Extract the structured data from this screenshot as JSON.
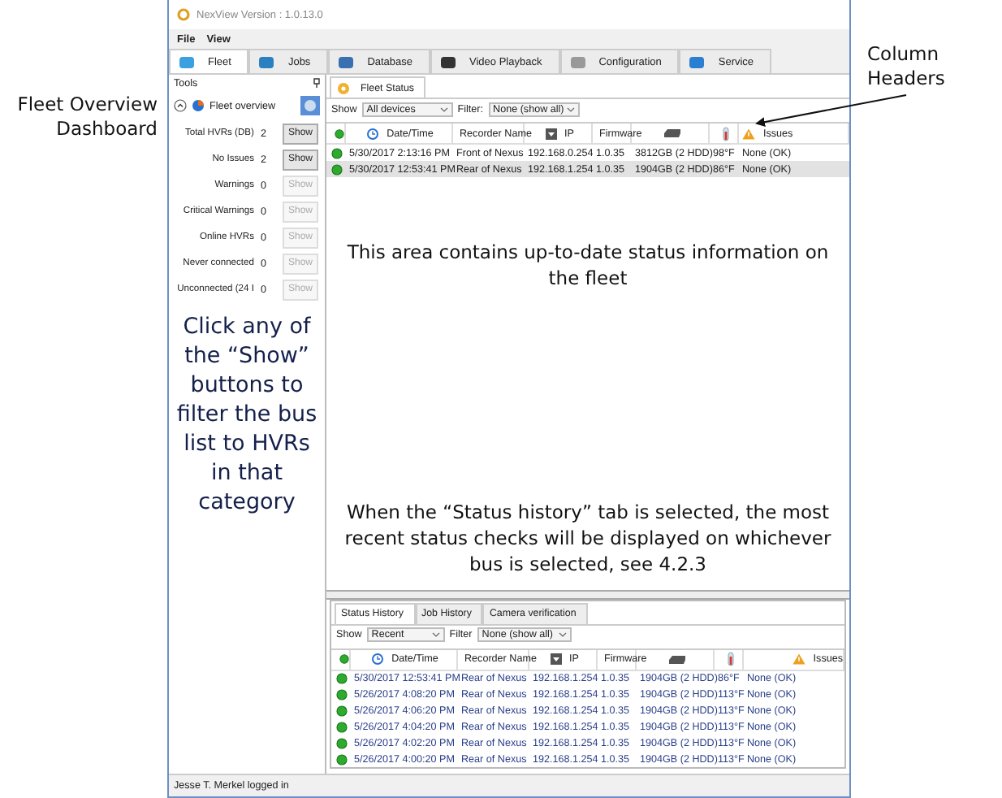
{
  "annotations": {
    "left": "Fleet Overview Dashboard",
    "right": "Column Headers",
    "panel": "Click any of the “Show” buttons to filter the bus list to HVRs in that category",
    "fleet": "This area contains up-to-date status information on the fleet",
    "history": "When the “Status history” tab is selected, the most recent status checks will be displayed on whichever bus is selected, see 4.2.3"
  },
  "window": {
    "title": "NexView Version : 1.0.13.0"
  },
  "menu": [
    "File",
    "View"
  ],
  "tabs": [
    {
      "label": "Fleet",
      "selected": true
    },
    {
      "label": "Jobs",
      "selected": false
    },
    {
      "label": "Database",
      "selected": false
    },
    {
      "label": "Video Playback",
      "selected": false
    },
    {
      "label": "Configuration",
      "selected": false
    },
    {
      "label": "Service",
      "selected": false
    }
  ],
  "tools": {
    "title": "Tools",
    "overview": "Fleet overview",
    "stats": [
      {
        "label": "Total HVRs (DB)",
        "count": "2",
        "button": "Show",
        "disabled": false
      },
      {
        "label": "No Issues",
        "count": "2",
        "button": "Show",
        "disabled": false
      },
      {
        "label": "Warnings",
        "count": "0",
        "button": "Show",
        "disabled": true
      },
      {
        "label": "Critical Warnings",
        "count": "0",
        "button": "Show",
        "disabled": true
      },
      {
        "label": "Online HVRs",
        "count": "0",
        "button": "Show",
        "disabled": true
      },
      {
        "label": "Never connected",
        "count": "0",
        "button": "Show",
        "disabled": true
      },
      {
        "label": "Unconnected (24 I",
        "count": "0",
        "button": "Show",
        "disabled": true
      }
    ]
  },
  "fleet_status": {
    "tab": "Fleet Status",
    "show_label": "Show",
    "show_value": "All devices",
    "filter_label": "Filter:",
    "filter_value": "None (show all)",
    "columns": [
      "Date/Time",
      "Recorder Name",
      "IP",
      "Firmware",
      "Issues"
    ],
    "rows": [
      {
        "datetime": "5/30/2017 2:13:16 PM",
        "recorder": "Front of Nexus",
        "ip": "192.168.0.254",
        "firmware": "1.0.35",
        "storage": "3812GB (2 HDD)",
        "temp": "98°F",
        "issues": "None (OK)",
        "selected": false
      },
      {
        "datetime": "5/30/2017 12:53:41 PM",
        "recorder": "Rear of Nexus",
        "ip": "192.168.1.254",
        "firmware": "1.0.35",
        "storage": "1904GB (2 HDD)",
        "temp": "86°F",
        "issues": "None (OK)",
        "selected": true
      }
    ]
  },
  "history": {
    "tabs": [
      {
        "label": "Status History",
        "selected": true
      },
      {
        "label": "Job History",
        "selected": false
      },
      {
        "label": "Camera verification",
        "selected": false
      }
    ],
    "show_label": "Show",
    "show_value": "Recent",
    "filter_label": "Filter",
    "filter_value": "None (show all)",
    "columns": [
      "Date/Time",
      "Recorder Name",
      "IP",
      "Firmware",
      "Issues"
    ],
    "rows": [
      {
        "datetime": "5/30/2017 12:53:41 PM",
        "recorder": "Rear of Nexus",
        "ip": "192.168.1.254",
        "firmware": "1.0.35",
        "storage": "1904GB (2 HDD)",
        "temp": "86°F",
        "issues": "None (OK)"
      },
      {
        "datetime": "5/26/2017 4:08:20 PM",
        "recorder": "Rear of Nexus",
        "ip": "192.168.1.254",
        "firmware": "1.0.35",
        "storage": "1904GB (2 HDD)",
        "temp": "113°F",
        "issues": "None (OK)"
      },
      {
        "datetime": "5/26/2017 4:06:20 PM",
        "recorder": "Rear of Nexus",
        "ip": "192.168.1.254",
        "firmware": "1.0.35",
        "storage": "1904GB (2 HDD)",
        "temp": "113°F",
        "issues": "None (OK)"
      },
      {
        "datetime": "5/26/2017 4:04:20 PM",
        "recorder": "Rear of Nexus",
        "ip": "192.168.1.254",
        "firmware": "1.0.35",
        "storage": "1904GB (2 HDD)",
        "temp": "113°F",
        "issues": "None (OK)"
      },
      {
        "datetime": "5/26/2017 4:02:20 PM",
        "recorder": "Rear of Nexus",
        "ip": "192.168.1.254",
        "firmware": "1.0.35",
        "storage": "1904GB (2 HDD)",
        "temp": "113°F",
        "issues": "None (OK)"
      },
      {
        "datetime": "5/26/2017 4:00:20 PM",
        "recorder": "Rear of Nexus",
        "ip": "192.168.1.254",
        "firmware": "1.0.35",
        "storage": "1904GB (2 HDD)",
        "temp": "113°F",
        "issues": "None (OK)"
      }
    ]
  },
  "status_bar": "Jesse T. Merkel logged in"
}
